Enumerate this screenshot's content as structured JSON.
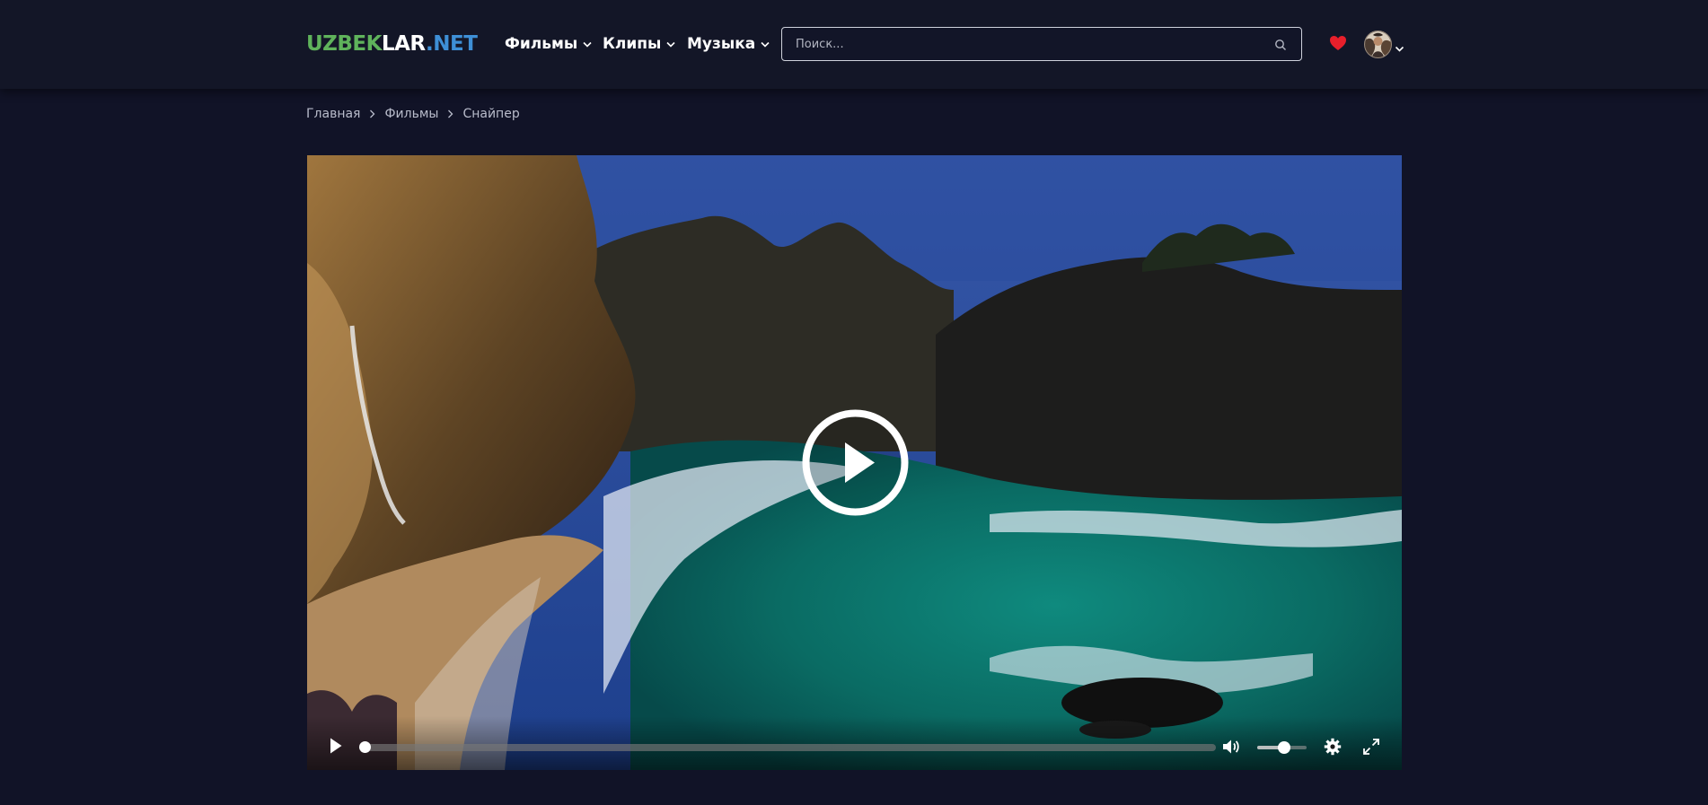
{
  "logo": {
    "part1": "UZBEK",
    "part2": "LAR",
    "part3": ".NET"
  },
  "nav": {
    "items": [
      {
        "label": "Фильмы"
      },
      {
        "label": "Клипы"
      },
      {
        "label": "Музыка"
      }
    ]
  },
  "search": {
    "placeholder": "Поиск...",
    "value": ""
  },
  "breadcrumb": {
    "items": [
      "Главная",
      "Фильмы",
      "Снайпер"
    ]
  },
  "player": {
    "progress_fraction": 0.0,
    "volume_fraction": 0.55
  },
  "icons": {
    "search": "search-icon",
    "favorites": "heart-icon",
    "avatar_menu": "chevron-down-icon",
    "play": "play-icon",
    "volume": "volume-icon",
    "settings": "gear-icon",
    "fullscreen": "expand-icon"
  },
  "colors": {
    "background": "#111327",
    "header": "#131627",
    "logo_green": "#5fb35b",
    "logo_blue": "#3e8fd6",
    "heart": "#e81f2b"
  }
}
